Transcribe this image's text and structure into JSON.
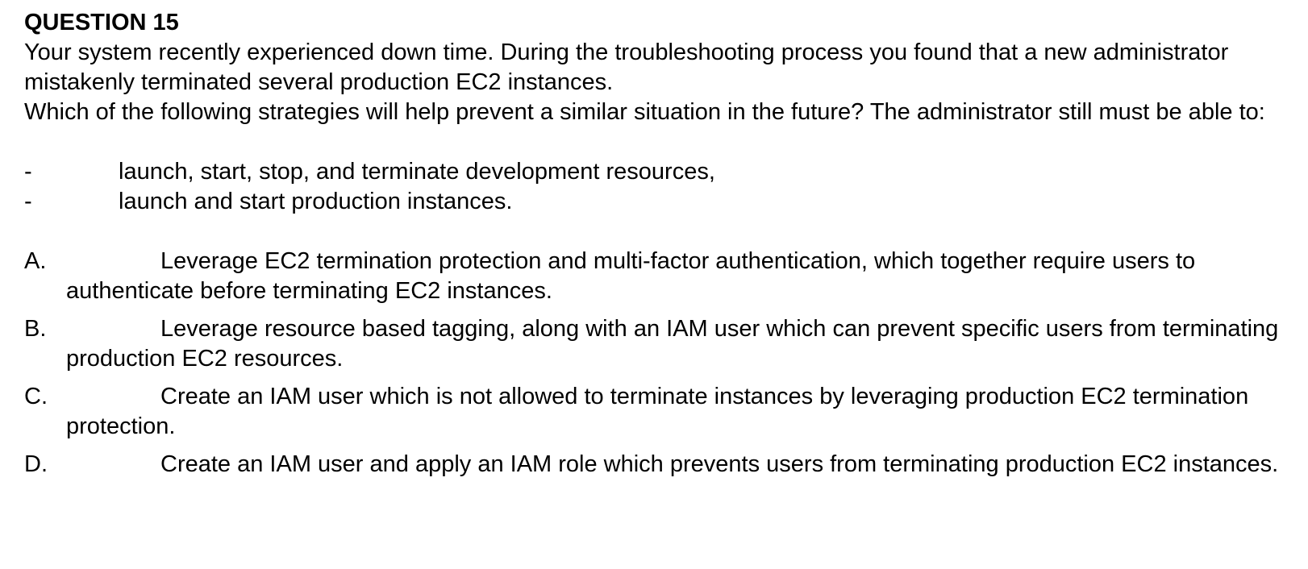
{
  "question": {
    "title": "QUESTION 15",
    "stem_lines": [
      "Your system recently experienced down time. During the troubleshooting process you found that a new administrator mistakenly terminated several production EC2 instances.",
      "Which of the following strategies will help prevent a similar situation in the future? The administrator still must be able to:"
    ],
    "requirements": [
      {
        "dash": "-",
        "text": "launch, start, stop, and terminate development resources,"
      },
      {
        "dash": "-",
        "text": "launch and start production instances."
      }
    ],
    "options": [
      {
        "letter": "A.",
        "text": "Leverage EC2 termination protection and multi-factor authentication, which together require users to authenticate before terminating EC2 instances."
      },
      {
        "letter": "B.",
        "text": "Leverage resource based tagging, along with an IAM user which can prevent specific users from terminating production EC2 resources."
      },
      {
        "letter": "C.",
        "text": "Create an IAM user which is not allowed to terminate instances by leveraging production EC2 termination protection."
      },
      {
        "letter": "D.",
        "text": "Create an IAM user and apply an IAM role which prevents users from terminating production EC2 instances."
      }
    ]
  }
}
